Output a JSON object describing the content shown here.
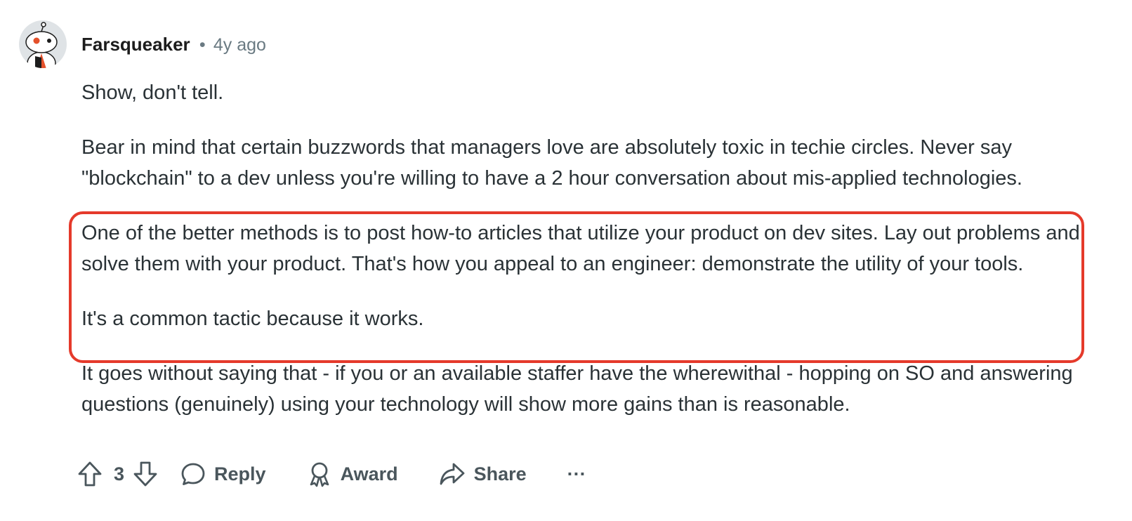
{
  "comment": {
    "author": "Farsqueaker",
    "separator": "•",
    "time_ago": "4y ago",
    "paragraphs": [
      "Show, don't tell.",
      "Bear in mind that certain buzzwords that managers love are absolutely toxic in techie circles. Never say \"blockchain\" to a dev unless you're willing to have a 2 hour conversation about mis-applied technologies.",
      "One of the better methods is to post how-to articles that utilize your product on dev sites. Lay out problems and solve them with your product. That's how you appeal to an engineer: demonstrate the utility of your tools.",
      "It's a common tactic because it works.",
      "It goes without saying that - if you or an available staffer have the wherewithal - hopping on SO and answering questions (genuinely) using your technology will show more gains than is reasonable."
    ],
    "highlight_color": "#e53a2b"
  },
  "actions": {
    "vote_count": "3",
    "reply_label": "Reply",
    "award_label": "Award",
    "share_label": "Share",
    "more_label": "···"
  },
  "icons": {
    "upvote": "upvote-arrow-icon",
    "downvote": "downvote-arrow-icon",
    "reply": "speech-bubble-icon",
    "award": "award-ribbon-icon",
    "share": "share-arrow-icon"
  }
}
